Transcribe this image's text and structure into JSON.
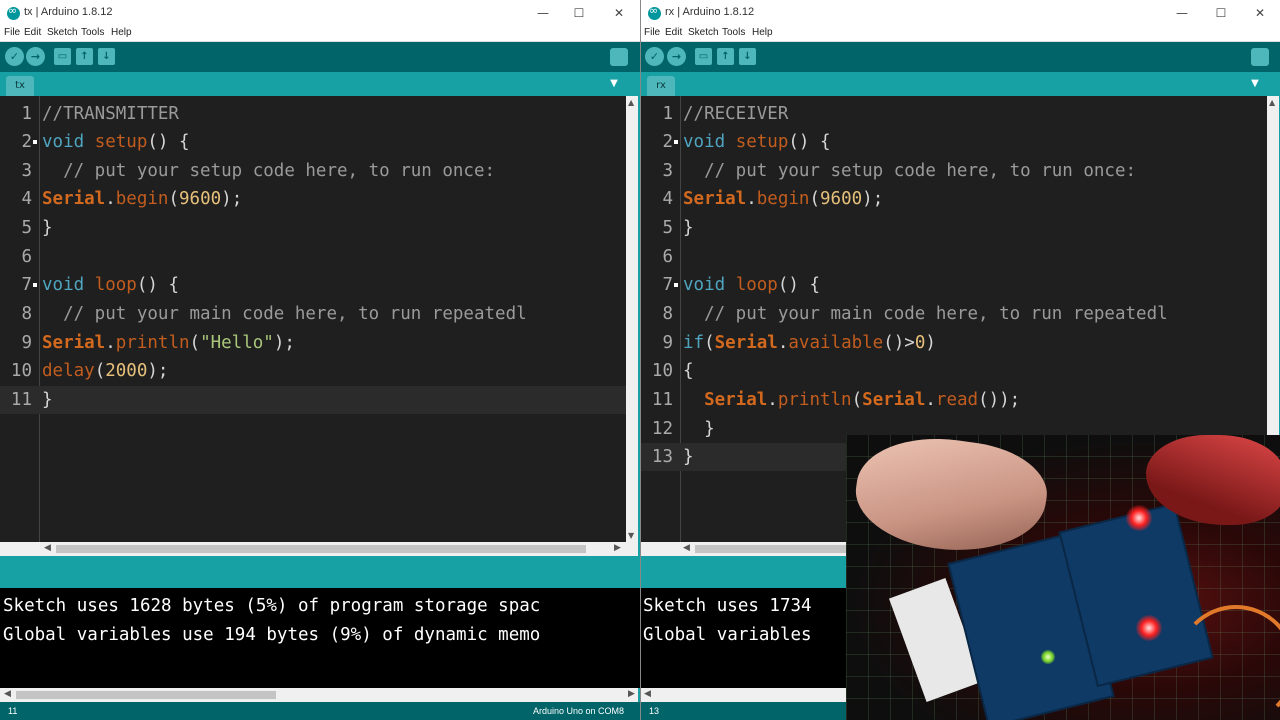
{
  "tx": {
    "title": "tx | Arduino 1.8.12",
    "menu": [
      "File",
      "Edit",
      "Sketch",
      "Tools",
      "Help"
    ],
    "tab": "tx",
    "lines": [
      {
        "n": "1",
        "text": "//TRANSMITTER"
      },
      {
        "n": "2",
        "text": "void setup() {"
      },
      {
        "n": "3",
        "text": "  // put your setup code here, to run once:"
      },
      {
        "n": "4",
        "text": "Serial.begin(9600);"
      },
      {
        "n": "5",
        "text": "}"
      },
      {
        "n": "6",
        "text": ""
      },
      {
        "n": "7",
        "text": "void loop() {"
      },
      {
        "n": "8",
        "text": "  // put your main code here, to run repeatedl"
      },
      {
        "n": "9",
        "text": "Serial.println(\"Hello\");"
      },
      {
        "n": "10",
        "text": "delay(2000);"
      },
      {
        "n": "11",
        "text": "}"
      }
    ],
    "console": [
      "Sketch uses 1628 bytes (5%) of program storage spac",
      "Global variables use 194 bytes (9%) of dynamic memo"
    ],
    "status_line": "11",
    "status_board": "Arduino Uno on COM8"
  },
  "rx": {
    "title": "rx | Arduino 1.8.12",
    "menu": [
      "File",
      "Edit",
      "Sketch",
      "Tools",
      "Help"
    ],
    "tab": "rx",
    "lines": [
      {
        "n": "1",
        "text": "//RECEIVER"
      },
      {
        "n": "2",
        "text": "void setup() {"
      },
      {
        "n": "3",
        "text": "  // put your setup code here, to run once:"
      },
      {
        "n": "4",
        "text": "Serial.begin(9600);"
      },
      {
        "n": "5",
        "text": "}"
      },
      {
        "n": "6",
        "text": ""
      },
      {
        "n": "7",
        "text": "void loop() {"
      },
      {
        "n": "8",
        "text": "  // put your main code here, to run repeatedl"
      },
      {
        "n": "9",
        "text": "if(Serial.available()>0)"
      },
      {
        "n": "10",
        "text": "{"
      },
      {
        "n": "11",
        "text": "  Serial.println(Serial.read());"
      },
      {
        "n": "12",
        "text": "  }"
      },
      {
        "n": "13",
        "text": "}"
      }
    ],
    "console": [
      "Sketch uses 1734",
      "Global variables"
    ],
    "status_line": "13"
  },
  "window_controls": {
    "minimize": "—",
    "maximize": "☐",
    "close": "✕"
  },
  "colors": {
    "teal": "#17a1a5",
    "toolbar": "#006468",
    "editor_bg": "#1f1f1f",
    "keyword": "#4fa4bf",
    "object": "#d2691e"
  }
}
